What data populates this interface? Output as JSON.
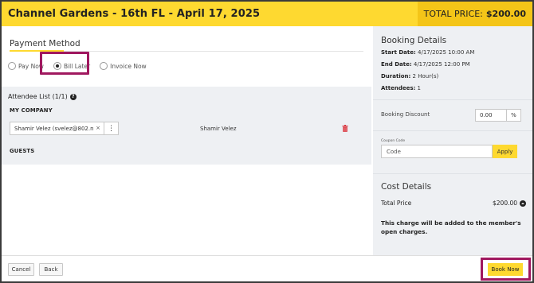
{
  "header": {
    "title": "Channel Gardens - 16th FL - April 17, 2025",
    "total_label": "TOTAL PRICE:",
    "total_value": "$200.00"
  },
  "payment": {
    "title": "Payment Method",
    "options": [
      "Pay Now",
      "Bill Later",
      "Invoice Now"
    ],
    "selected": "Bill Later"
  },
  "attendees": {
    "title": "Attendee List (1/1)",
    "company_heading": "MY COMPANY",
    "input_value": "Shamir Velez (svelez@802.n",
    "attendee_name": "Shamir Velez",
    "guests_heading": "GUESTS"
  },
  "booking_details": {
    "title": "Booking Details",
    "start_label": "Start Date:",
    "start_value": "4/17/2025 10:00 AM",
    "end_label": "End Date:",
    "end_value": "4/17/2025 12:00 PM",
    "duration_label": "Duration:",
    "duration_value": "2 Hour(s)",
    "attendees_label": "Attendees:",
    "attendees_value": "1"
  },
  "discount": {
    "label": "Booking Discount",
    "value": "0.00",
    "unit": "%"
  },
  "coupon": {
    "label": "Coupon Code",
    "placeholder": "Code",
    "button": "Apply"
  },
  "cost": {
    "title": "Cost Details",
    "total_label": "Total Price",
    "total_value": "$200.00",
    "note": "This charge will be added to the member's open charges."
  },
  "footer": {
    "cancel": "Cancel",
    "back": "Back",
    "book": "Book Now"
  },
  "colors": {
    "accent": "#fed930",
    "highlight": "#a0185f",
    "panel": "#eef0f3",
    "delete": "#d9363e"
  }
}
